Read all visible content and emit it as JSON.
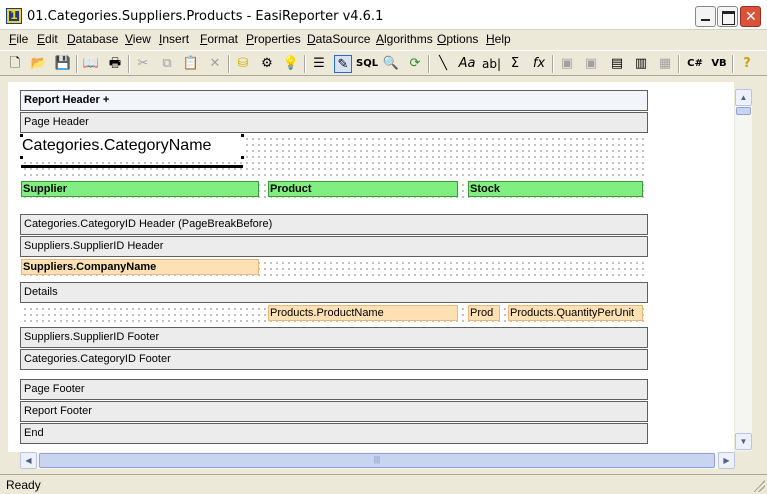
{
  "window": {
    "title": "01.Categories.Suppliers.Products - EasiReporter v4.6.1",
    "icon_label": "1"
  },
  "menu": [
    "File",
    "Edit",
    "Database",
    "View",
    "Insert",
    "Format",
    "Properties",
    "DataSource",
    "Algorithms",
    "Options",
    "Help"
  ],
  "toolbar": {
    "sql_label": "SQL",
    "csharp_label": "C#",
    "vb_label": "VB",
    "fx_label": "fx",
    "sigma_label": "Σ",
    "text_label": "Aa",
    "ab_label": "ab|"
  },
  "report": {
    "bands": {
      "report_header": "Report Header +",
      "page_header": "Page Header",
      "category_header": "Categories.CategoryID  Header  (PageBreakBefore)",
      "supplier_header": "Suppliers.SupplierID Header",
      "details": "Details",
      "supplier_footer": "Suppliers.SupplierID Footer",
      "category_footer": "Categories.CategoryID Footer",
      "page_footer": "Page Footer",
      "report_footer": "Report Footer",
      "end": "End"
    },
    "fields": {
      "category_name": "Categories.CategoryName",
      "col_supplier": "Supplier",
      "col_product": "Product",
      "col_stock": "Stock",
      "company_name": "Suppliers.CompanyName",
      "product_name": "Products.ProductName",
      "prod_short": "Prod",
      "quantity_per_unit": "Products.QuantityPerUnit"
    }
  },
  "status": {
    "text": "Ready"
  }
}
